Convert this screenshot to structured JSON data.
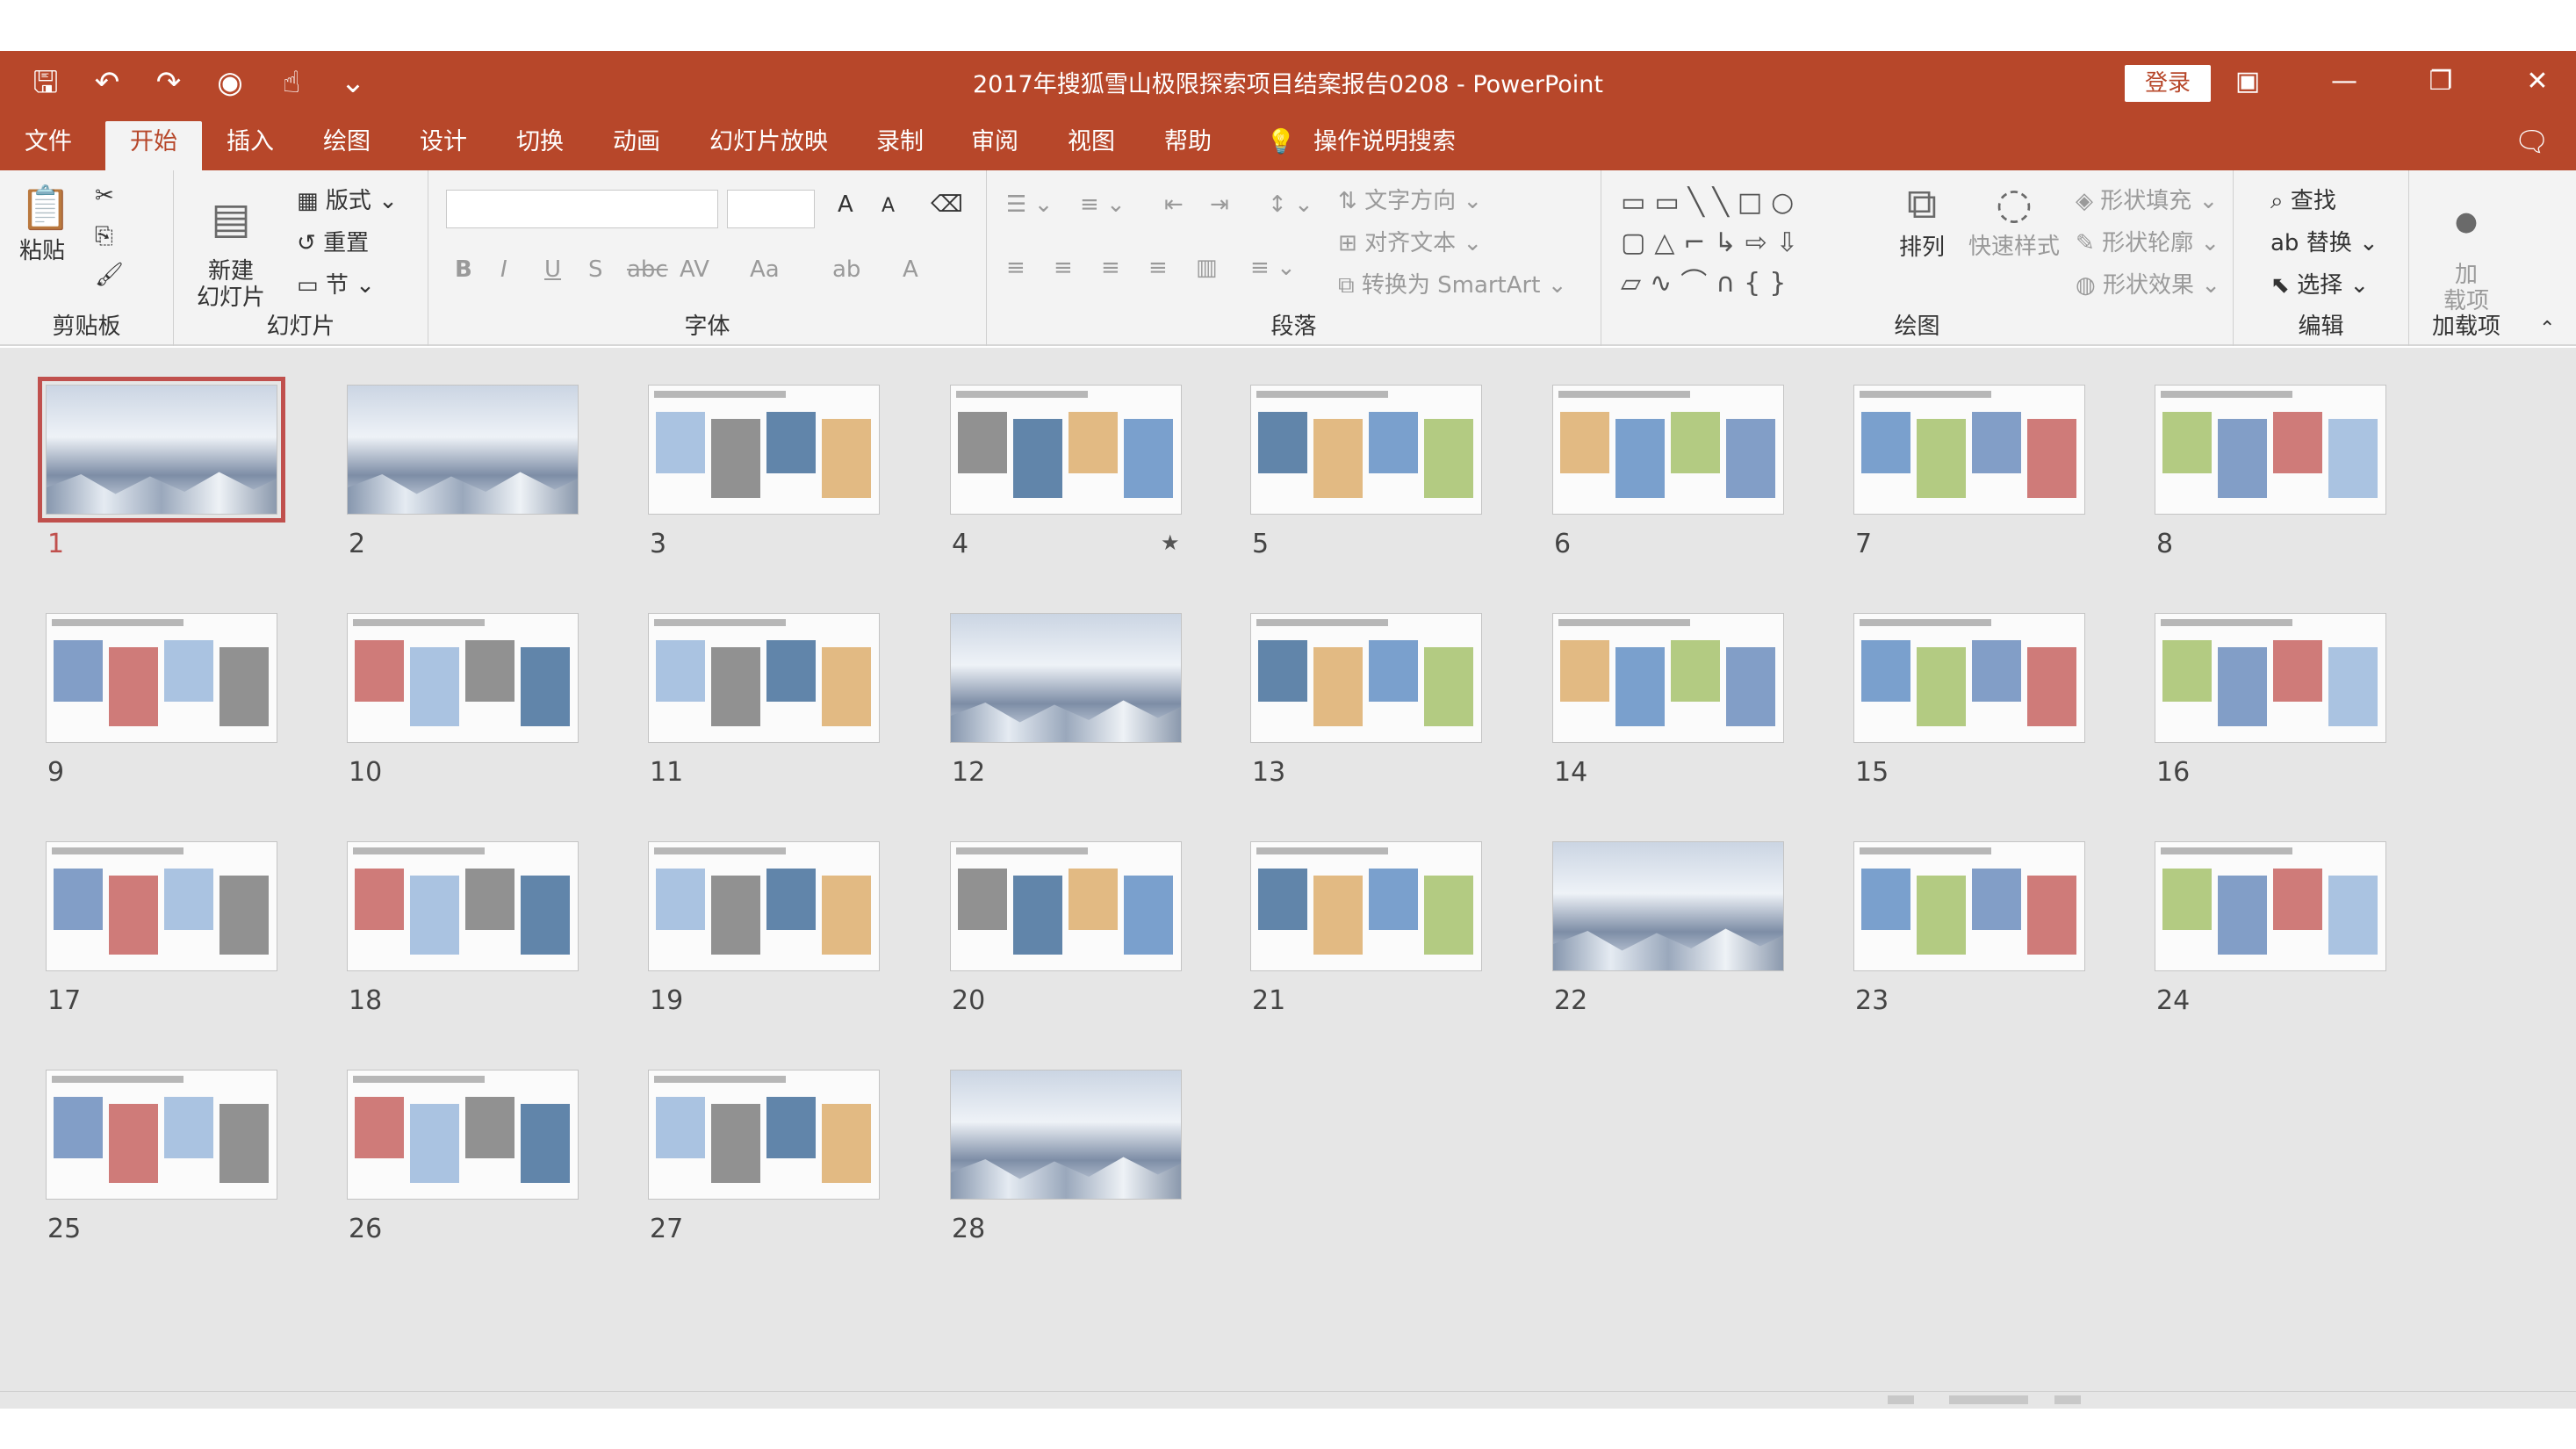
{
  "app": {
    "title": "2017年搜狐雪山极限探索项目结案报告0208 - PowerPoint",
    "login_label": "登录",
    "accent_color": "#b7472a"
  },
  "qat_icons": [
    "save-icon",
    "undo-icon",
    "redo-icon",
    "present-icon",
    "touch-mode-icon",
    "customize-icon"
  ],
  "tabs": [
    {
      "label": "文件"
    },
    {
      "label": "开始"
    },
    {
      "label": "插入"
    },
    {
      "label": "绘图"
    },
    {
      "label": "设计"
    },
    {
      "label": "切换"
    },
    {
      "label": "动画"
    },
    {
      "label": "幻灯片放映"
    },
    {
      "label": "录制"
    },
    {
      "label": "审阅"
    },
    {
      "label": "视图"
    },
    {
      "label": "帮助"
    }
  ],
  "tell_me": "操作说明搜索",
  "ribbon": {
    "clipboard": {
      "label": "剪贴板",
      "paste": "粘贴"
    },
    "slides": {
      "label": "幻灯片",
      "new_slide": "新建\n幻灯片",
      "layout": "版式",
      "reset": "重置",
      "section": "节"
    },
    "font": {
      "label": "字体",
      "bold": "B",
      "italic": "I",
      "underline": "U",
      "shadow": "S",
      "strike": "abc",
      "spacing": "AV",
      "case": "Aa",
      "grow": "A",
      "shrink": "A",
      "color": "A"
    },
    "paragraph": {
      "label": "段落",
      "text_direction": "文字方向",
      "align_text": "对齐文本",
      "smartart": "转换为 SmartArt"
    },
    "drawing": {
      "label": "绘图",
      "arrange": "排列",
      "quick_styles": "快速样式",
      "fill": "形状填充",
      "outline": "形状轮廓",
      "effects": "形状效果"
    },
    "editing": {
      "label": "编辑",
      "find": "查找",
      "replace": "替换",
      "select": "选择"
    },
    "addins": {
      "label": "加载项",
      "addin": "加\n载项"
    }
  },
  "slides": [
    {
      "n": "1",
      "kind": "snow",
      "selected": true
    },
    {
      "n": "2",
      "kind": "snow"
    },
    {
      "n": "3",
      "kind": "doc"
    },
    {
      "n": "4",
      "kind": "doc",
      "star": "★"
    },
    {
      "n": "5",
      "kind": "doc"
    },
    {
      "n": "6",
      "kind": "doc"
    },
    {
      "n": "7",
      "kind": "doc"
    },
    {
      "n": "8",
      "kind": "doc"
    },
    {
      "n": "9",
      "kind": "doc"
    },
    {
      "n": "10",
      "kind": "doc"
    },
    {
      "n": "11",
      "kind": "doc"
    },
    {
      "n": "12",
      "kind": "snow"
    },
    {
      "n": "13",
      "kind": "doc"
    },
    {
      "n": "14",
      "kind": "doc"
    },
    {
      "n": "15",
      "kind": "doc"
    },
    {
      "n": "16",
      "kind": "doc"
    },
    {
      "n": "17",
      "kind": "doc"
    },
    {
      "n": "18",
      "kind": "doc"
    },
    {
      "n": "19",
      "kind": "doc"
    },
    {
      "n": "20",
      "kind": "doc"
    },
    {
      "n": "21",
      "kind": "doc"
    },
    {
      "n": "22",
      "kind": "snow"
    },
    {
      "n": "23",
      "kind": "doc"
    },
    {
      "n": "24",
      "kind": "doc"
    },
    {
      "n": "25",
      "kind": "doc"
    },
    {
      "n": "26",
      "kind": "doc"
    },
    {
      "n": "27",
      "kind": "doc"
    },
    {
      "n": "28",
      "kind": "snow"
    }
  ]
}
